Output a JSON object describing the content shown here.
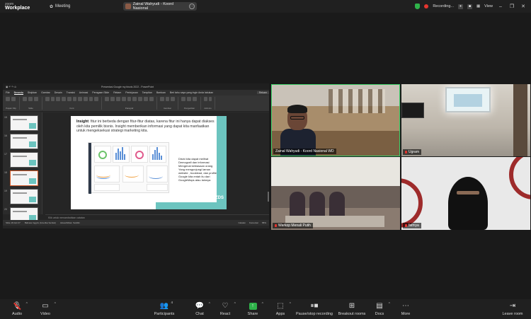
{
  "titlebar": {
    "brand_line1": "zoom",
    "brand_line2": "Workplace",
    "meeting_label": "Meeting",
    "active_speaker": "Zainal Wahyudi - Koord Nasional",
    "recording_label": "Recording...",
    "view_label": "View"
  },
  "powerpoint": {
    "window_title": "Presentasi Google my bisnis 2022 - PowerPoint",
    "search_placeholder": "Beri tahu saya yang ingin Anda lakukan",
    "tabs": [
      "File",
      "Beranda",
      "Sisipkan",
      "Gambar",
      "Desain",
      "Transisi",
      "Animasi",
      "Peragaan Slide",
      "Rekam",
      "Peninjauan",
      "Tampilan",
      "Bantuan"
    ],
    "active_tab": "Beranda",
    "record_button": "Rekam",
    "ribbon_groups": [
      "Papan Klip",
      "Slide",
      "Font",
      "Paragraf",
      "Gambar",
      "Pengeditan",
      "Add-ins"
    ],
    "thumbnail_numbers": [
      "15",
      "16",
      "17",
      "18",
      "19",
      "20"
    ],
    "slide": {
      "heading": "Insight",
      "body": ": fitur ini berbeda dengan fitur-fitur diatas, karena fitur ini hanya dapat diakses oleh kita pemilik bisnis. Insight memberikan informasi yang dapat kita manfaatkan untuk mengeksekusi strategi marketing kita.",
      "note": "Disini kita dapat melihat Demografi dan informasi Mengenai kebiasaan orang Yang mengunjungi laman website , booklead, dan profile Google kita entah itu dari GoogleMaps atau lainnya",
      "logo": "ZDS"
    },
    "notes_placeholder": "Klik untuk menambahkan catatan",
    "status": {
      "slide_count": "Slide 18 dari 27",
      "language": "Bahasa Inggris (Amerika Serikat)",
      "accessibility": "Aksesibilitas: Selidiki",
      "notes": "Catatan",
      "comments": "Komentar",
      "zoom": "58%"
    }
  },
  "participants_tiles": [
    {
      "name": "Zainal Wahyudi - Koord Nasional WD",
      "muted": false
    },
    {
      "name": "Ugram",
      "muted": true
    },
    {
      "name": "Warkop Menali Putih",
      "muted": true
    },
    {
      "name": "fathiya",
      "muted": true
    }
  ],
  "toolbar": {
    "audio": "Audio",
    "video": "Video",
    "participants": "Participants",
    "participants_count": "4",
    "chat": "Chat",
    "react": "React",
    "share": "Share",
    "apps": "Apps",
    "pause_recording": "Pause/stop recording",
    "breakout": "Breakout rooms",
    "docs": "Docs",
    "more": "More",
    "leave": "Leave room"
  },
  "colors": {
    "active_border": "#3fd26a",
    "share_green": "#2fb34a",
    "muted_red": "#e5352f",
    "slide_teal": "#6cc4bf"
  }
}
